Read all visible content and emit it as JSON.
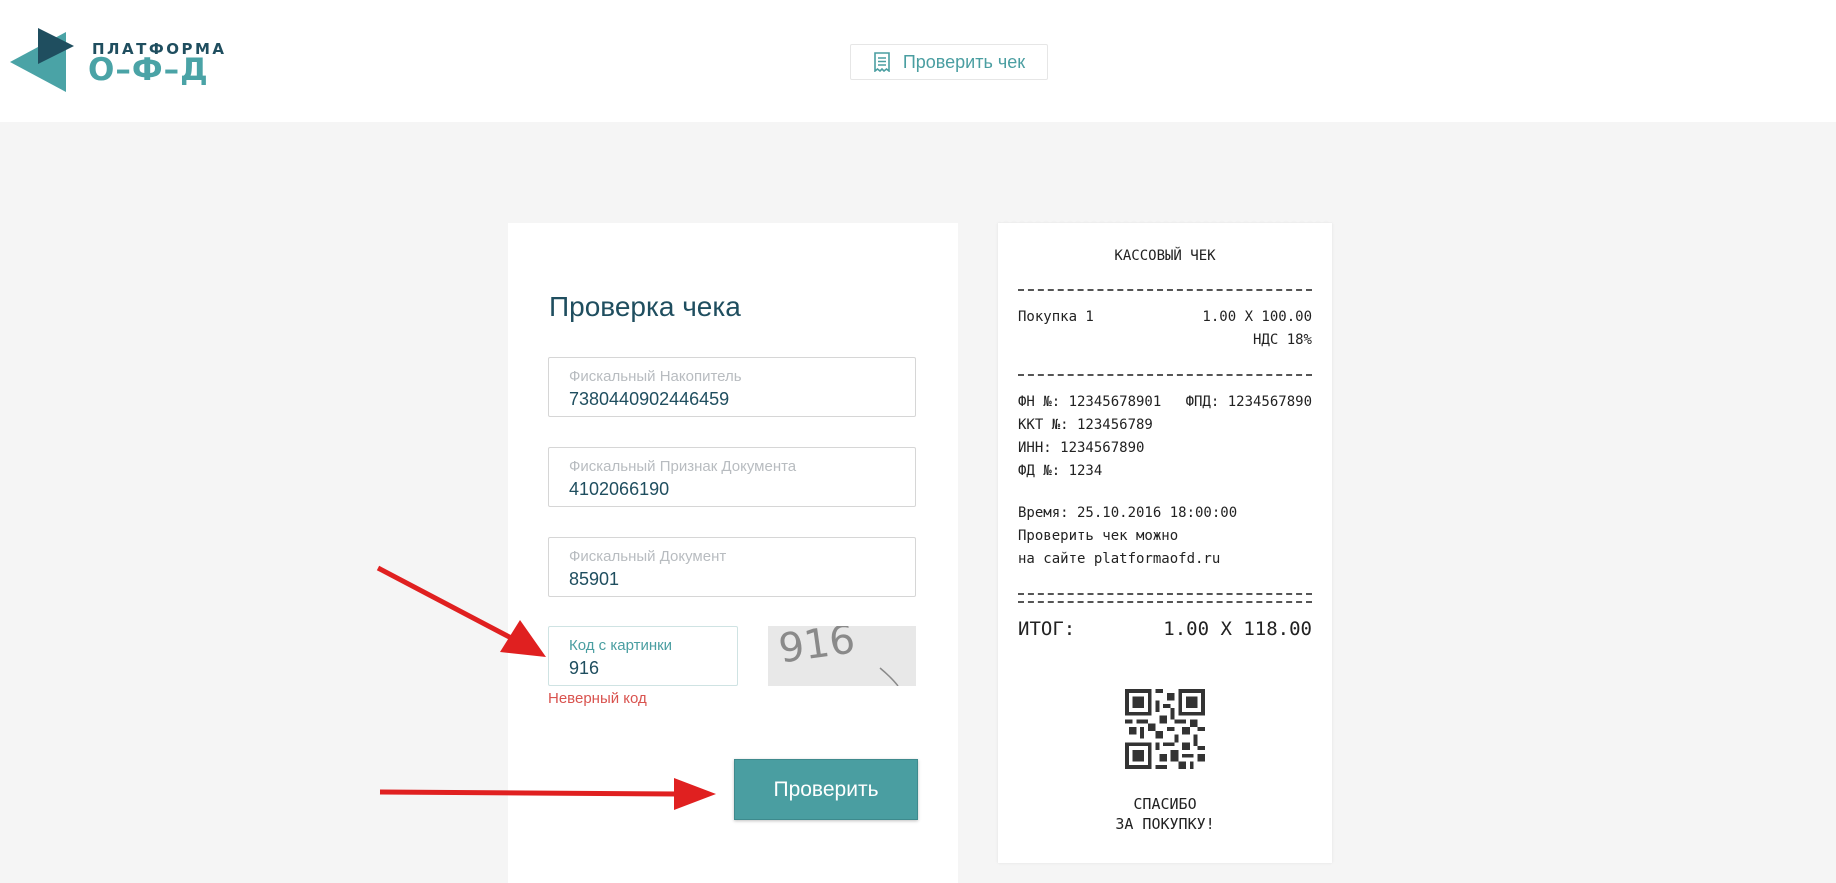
{
  "header": {
    "logo_top": "ПЛАТФОРМА",
    "logo_bottom": "О–Ф–Д",
    "check_button_label": "Проверить чек"
  },
  "form": {
    "title": "Проверка чека",
    "fields": [
      {
        "label": "Фискальный Накопитель",
        "value": "7380440902446459"
      },
      {
        "label": "Фискальный Признак Документа",
        "value": "4102066190"
      },
      {
        "label": "Фискальный Документ",
        "value": "85901"
      },
      {
        "label": "Код с картинки",
        "value": "916"
      }
    ],
    "captcha_text": "916",
    "error": "Неверный код",
    "submit_label": "Проверить"
  },
  "receipt": {
    "title": "КАССОВЫЙ ЧЕК",
    "item_name": "Покупка 1",
    "item_price": "1.00 X 100.00",
    "item_vat": "НДС 18%",
    "fn": "ФН №: 12345678901",
    "fpd": "ФПД: 1234567890",
    "kkt": "ККТ №: 123456789",
    "inn": "ИНН: 1234567890",
    "fd": "ФД №: 1234",
    "time": "Время: 25.10.2016 18:00:00",
    "check_hint_1": "Проверить чек можно",
    "check_hint_2": "на сайте platformaofd.ru",
    "total_label": "ИТОГ:",
    "total_value": "1.00 X 118.00",
    "thanks_1": "СПАСИБО",
    "thanks_2": "ЗА ПОКУПКУ!"
  },
  "colors": {
    "accent": "#4a9ea1",
    "dark": "#1f4e5f",
    "error": "#d9534f",
    "arrow": "#e02020"
  }
}
